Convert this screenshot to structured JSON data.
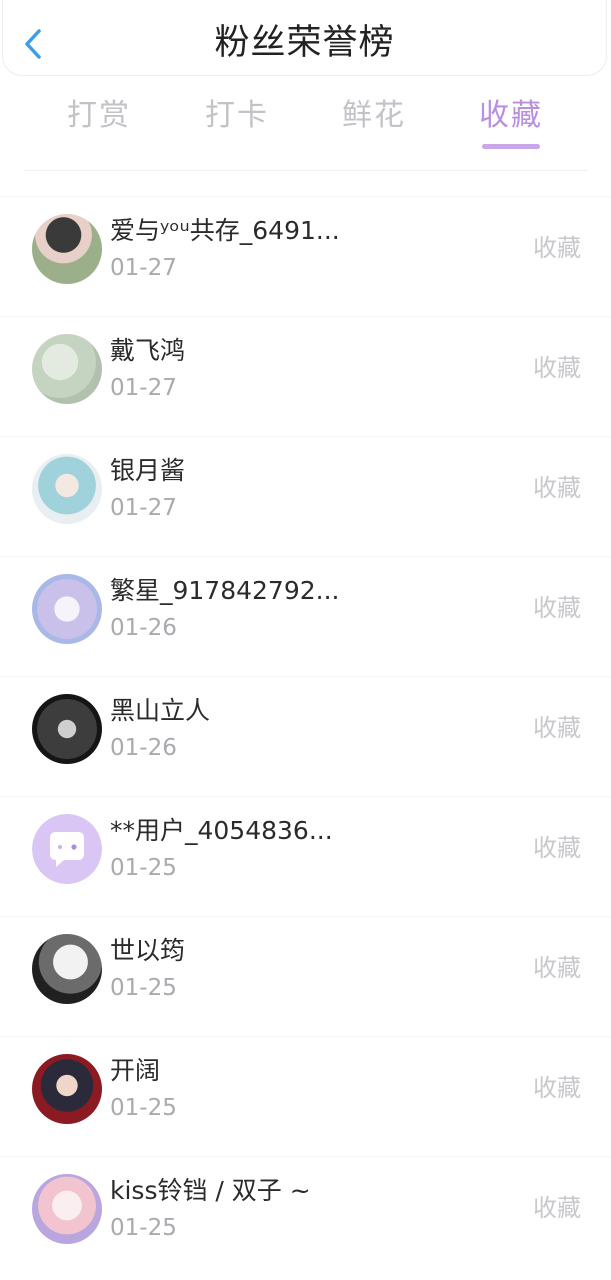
{
  "header": {
    "title": "粉丝荣誉榜",
    "back_icon": "chevron-left-icon"
  },
  "tabs": [
    {
      "label": "打赏",
      "active": false
    },
    {
      "label": "打卡",
      "active": false
    },
    {
      "label": "鲜花",
      "active": false
    },
    {
      "label": "收藏",
      "active": true
    }
  ],
  "colors": {
    "accent": "#b98fe0",
    "back": "#3b9ee8",
    "inactive_tab": "#c2c2c7"
  },
  "fans": [
    {
      "name": "爱与ʸᵒᵘ共存_6491...",
      "date": "01-27",
      "action": "收藏",
      "avatar": "photo-avatar"
    },
    {
      "name": "戴飞鸿",
      "date": "01-27",
      "action": "收藏",
      "avatar": "photo-avatar"
    },
    {
      "name": "银月酱",
      "date": "01-27",
      "action": "收藏",
      "avatar": "anime-avatar"
    },
    {
      "name": "繁星_917842792...",
      "date": "01-26",
      "action": "收藏",
      "avatar": "anime-avatar"
    },
    {
      "name": "黑山立人",
      "date": "01-26",
      "action": "收藏",
      "avatar": "photo-avatar"
    },
    {
      "name": "**用户_4054836...",
      "date": "01-25",
      "action": "收藏",
      "avatar": "default-chat-avatar"
    },
    {
      "name": "世以筠",
      "date": "01-25",
      "action": "收藏",
      "avatar": "photo-avatar"
    },
    {
      "name": "开阔",
      "date": "01-25",
      "action": "收藏",
      "avatar": "anime-avatar"
    },
    {
      "name": "kiss铃铛 / 双子 ~",
      "date": "01-25",
      "action": "收藏",
      "avatar": "anime-avatar"
    }
  ]
}
